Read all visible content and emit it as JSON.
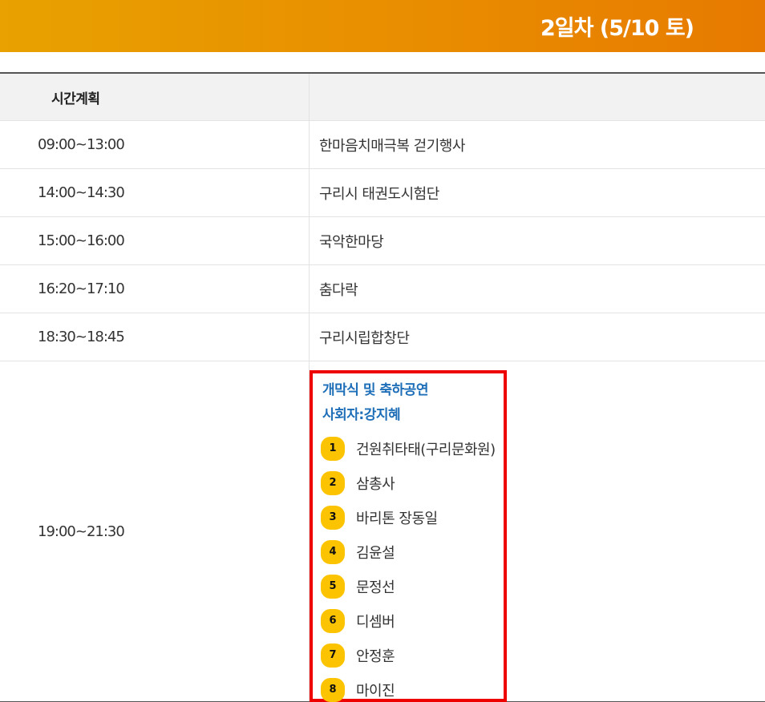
{
  "header": {
    "day_title": "2일차 (5/10 토)"
  },
  "table": {
    "col_time_header": "시간계획",
    "col_event_header": "",
    "rows": [
      {
        "time": "09:00~13:00",
        "event": "한마음치매극복 걷기행사"
      },
      {
        "time": "14:00~14:30",
        "event": "구리시 태권도시험단"
      },
      {
        "time": "15:00~16:00",
        "event": "국악한마당"
      },
      {
        "time": "16:20~17:10",
        "event": "춤다락"
      },
      {
        "time": "18:30~18:45",
        "event": "구리시립합창단"
      }
    ],
    "ceremony": {
      "time": "19:00~21:30",
      "title": "개막식 및 축하공연",
      "host": "사회자:강지혜",
      "performers": [
        {
          "num": "1",
          "name": "건원취타태(구리문화원)"
        },
        {
          "num": "2",
          "name": "삼총사"
        },
        {
          "num": "3",
          "name": "바리톤 장동일"
        },
        {
          "num": "4",
          "name": "김윤설"
        },
        {
          "num": "5",
          "name": "문정선"
        },
        {
          "num": "6",
          "name": "디셈버"
        },
        {
          "num": "7",
          "name": "안정훈"
        },
        {
          "num": "8",
          "name": "마이진"
        }
      ]
    }
  },
  "colors": {
    "banner_start": "#e8a100",
    "banner_end": "#e77a00",
    "highlight_border": "#ee0000",
    "ceremony_text": "#1e6fb8",
    "badge": "#fcc400"
  }
}
